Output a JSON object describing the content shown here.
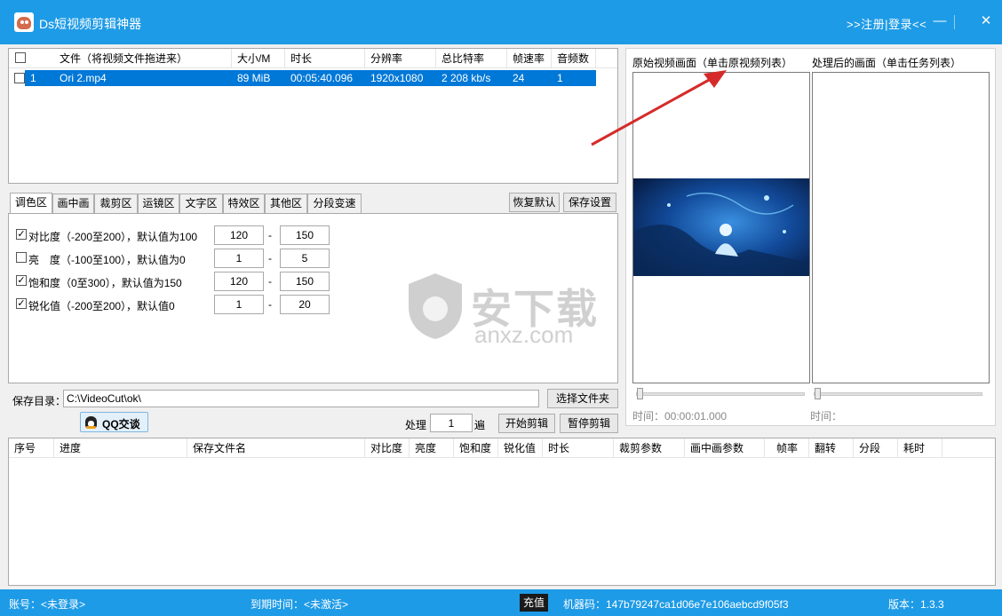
{
  "window": {
    "title": "Ds短视频剪辑神器",
    "register_login": ">>注册|登录<<",
    "minimize": "—",
    "maximize": "☐",
    "close": "✕"
  },
  "file_table": {
    "headers": [
      "文件（将视频文件拖进来）",
      "大小/M",
      "时长",
      "分辨率",
      "总比特率",
      "帧速率",
      "音频数"
    ],
    "rows": [
      {
        "index": "1",
        "file": "Ori 2.mp4",
        "size": "89 MiB",
        "duration": "00:05:40.096",
        "resolution": "1920x1080",
        "bitrate": "2 208 kb/s",
        "fps": "24",
        "audio": "1"
      }
    ]
  },
  "tabs": [
    "调色区",
    "画中画",
    "裁剪区",
    "运镜区",
    "文字区",
    "特效区",
    "其他区",
    "分段变速"
  ],
  "buttons": {
    "restore_default": "恢复默认",
    "save_settings": "保存设置",
    "choose_folder": "选择文件夹",
    "qq_chat": "QQ交谈",
    "start_edit": "开始剪辑",
    "pause_edit": "暂停剪辑"
  },
  "color_settings": [
    {
      "label": "对比度（-200至200），默认值为100",
      "checked": true,
      "from": "120",
      "to": "150"
    },
    {
      "label": "亮　度（-100至100），默认值为0",
      "checked": false,
      "from": "1",
      "to": "5"
    },
    {
      "label": "饱和度（0至300），默认值为150",
      "checked": true,
      "from": "120",
      "to": "150"
    },
    {
      "label": "锐化值（-200至200），默认值0",
      "checked": true,
      "from": "1",
      "to": "20"
    }
  ],
  "save_dir": {
    "label": "保存目录：",
    "value": "C:\\VideoCut\\ok\\"
  },
  "process": {
    "label": "处理",
    "count": "1",
    "unit": "遍"
  },
  "preview": {
    "original_label": "原始视频画面（单击原视频列表）",
    "processed_label": "处理后的画面（单击任务列表）",
    "original_time": "时间：00:00:01.000",
    "processed_time": "时间："
  },
  "task_table": {
    "headers": [
      "序号",
      "进度",
      "保存文件名",
      "对比度",
      "亮度",
      "饱和度",
      "锐化值",
      "时长",
      "裁剪参数",
      "画中画参数",
      "帧率",
      "翻转",
      "分段",
      "耗时"
    ]
  },
  "status": {
    "account": "账号：<未登录>",
    "expiry": "到期时间：<未激活>",
    "recharge": "充值",
    "machine_code": "机器码：147b79247ca1d06e7e106aebcd9f05f3",
    "version": "版本：1.3.3"
  },
  "watermark": {
    "text": "安下载",
    "domain": "anxz.com"
  },
  "colors": {
    "accent": "#1e9be6",
    "selection": "#0078d7"
  }
}
